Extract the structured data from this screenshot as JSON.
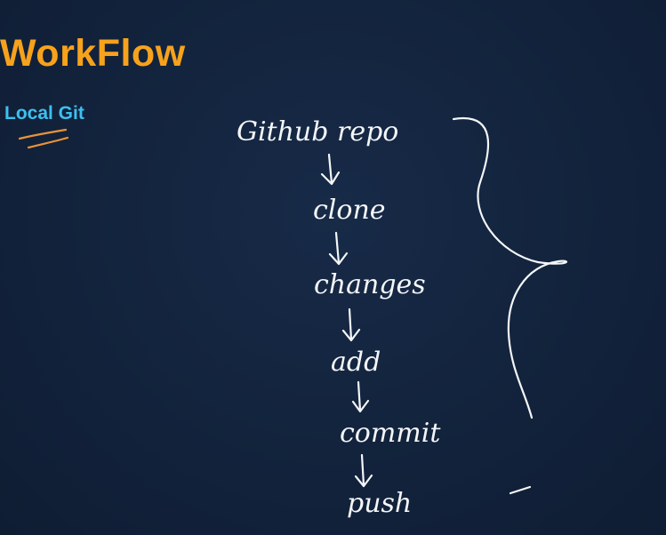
{
  "slide": {
    "title": "WorkFlow",
    "subtitle": "Local Git",
    "colors": {
      "background": "#13233d",
      "title": "#f7a21c",
      "subtitle": "#3cc0f0",
      "underline": "#e8933a",
      "handwriting": "#f4f6f8"
    }
  },
  "workflow": {
    "steps": [
      "Github repo",
      "clone",
      "changes",
      "add",
      "commit",
      "push"
    ]
  }
}
